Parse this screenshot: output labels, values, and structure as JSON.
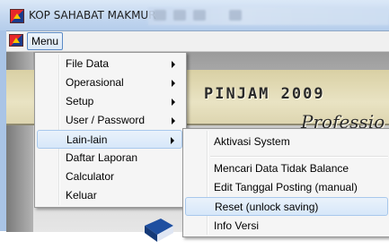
{
  "window": {
    "title": "KOP SAHABAT MAKMUR"
  },
  "menubar": {
    "menu_label": "Menu"
  },
  "background": {
    "banner_title": "PINJAM 2009",
    "banner_subtitle": "Professio"
  },
  "dropdown": {
    "items": [
      {
        "label": "File Data",
        "has_submenu": true
      },
      {
        "label": "Operasional",
        "has_submenu": true
      },
      {
        "label": "Setup",
        "has_submenu": true
      },
      {
        "label": "User / Password",
        "has_submenu": true
      },
      {
        "label": "Lain-lain",
        "has_submenu": true,
        "highlighted": true
      },
      {
        "label": "Daftar Laporan",
        "has_submenu": false
      },
      {
        "label": "Calculator",
        "has_submenu": false
      },
      {
        "label": "Keluar",
        "has_submenu": false
      }
    ]
  },
  "submenu": {
    "items": [
      {
        "label": "Aktivasi System"
      },
      {
        "label": "Mencari Data Tidak Balance"
      },
      {
        "label": "Edit Tanggal Posting (manual)"
      },
      {
        "label": "Reset (unlock saving)",
        "highlighted": true
      },
      {
        "label": "Info Versi"
      }
    ]
  },
  "colors": {
    "highlight": "#d7e7f9",
    "highlight_border": "#a8c8ec",
    "title_bar": "#c2d6ef"
  }
}
